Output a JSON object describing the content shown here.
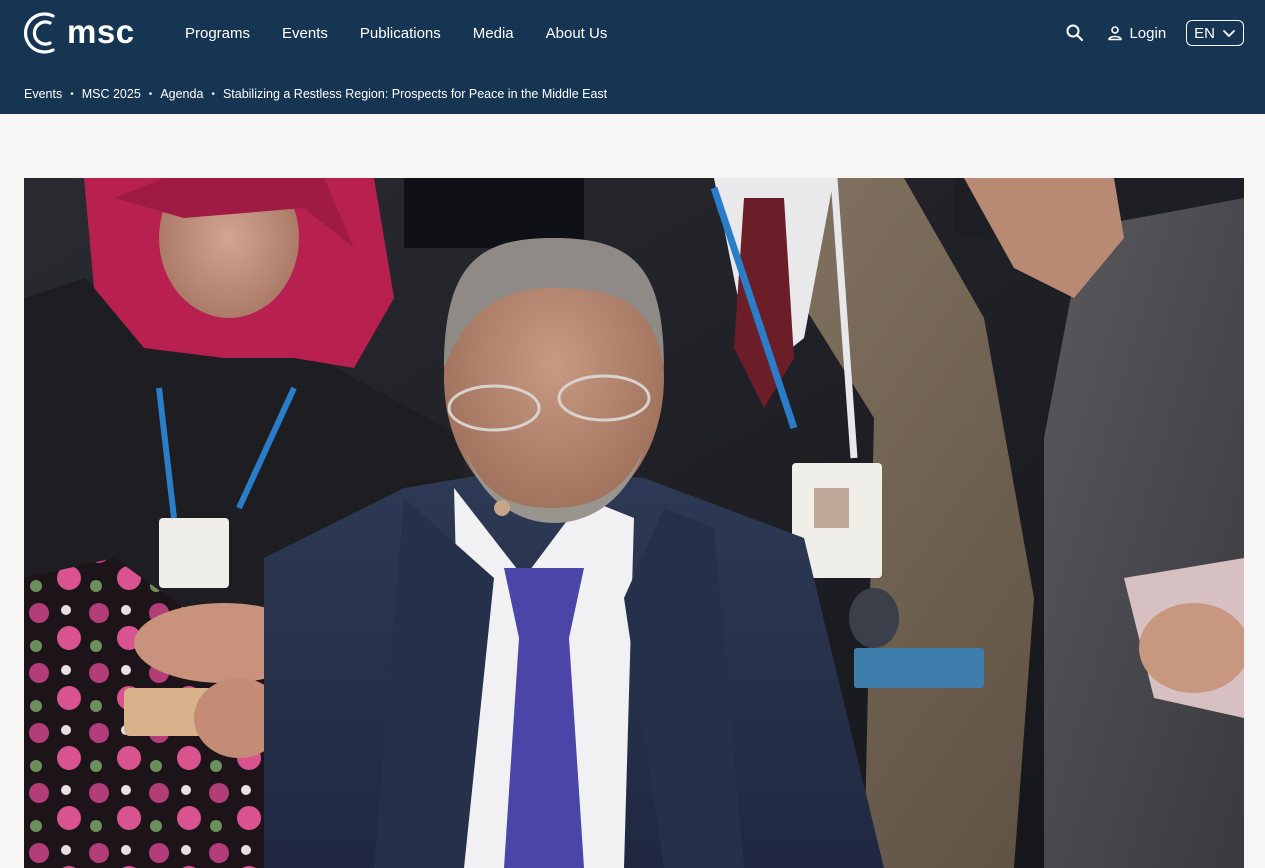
{
  "header": {
    "logo_text": "msc",
    "logo_icon": "msc-logo-icon",
    "nav": [
      {
        "label": "Programs"
      },
      {
        "label": "Events"
      },
      {
        "label": "Publications"
      },
      {
        "label": "Media"
      },
      {
        "label": "About Us"
      }
    ],
    "search_icon": "search-icon",
    "login_label": "Login",
    "login_icon": "user-icon",
    "language": "EN",
    "language_icon": "chevron-down-icon"
  },
  "breadcrumb": [
    {
      "label": "Events"
    },
    {
      "label": "MSC 2025"
    },
    {
      "label": "Agenda"
    },
    {
      "label": "Stabilizing a Restless Region: Prospects for Peace in the Middle East"
    }
  ],
  "colors": {
    "header_bg": "#163553",
    "page_bg": "#f7f6f4",
    "text_on_header": "#ffffff"
  }
}
